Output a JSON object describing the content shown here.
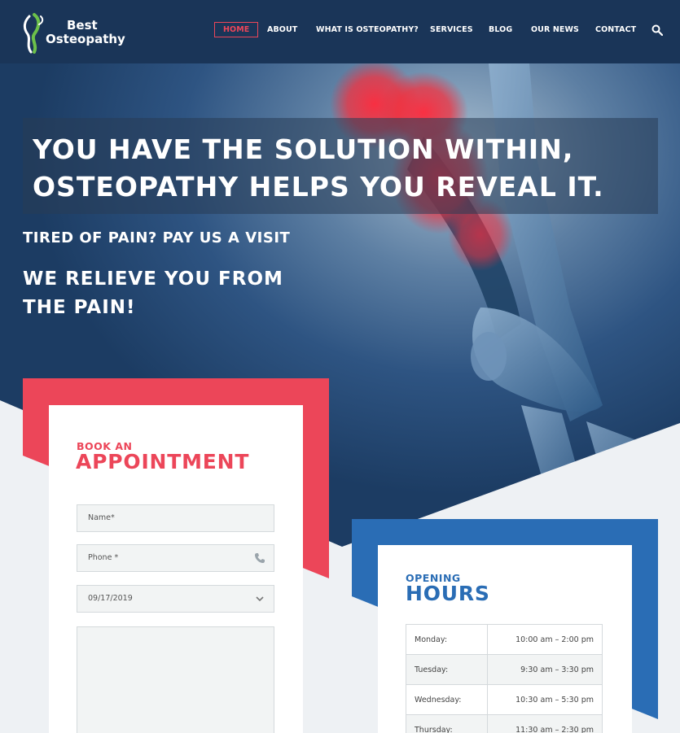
{
  "header": {
    "logo": {
      "line1": "Best",
      "line2": "Osteopathy"
    },
    "nav": [
      {
        "label": "HOME",
        "active": true
      },
      {
        "label": "ABOUT"
      },
      {
        "label": "WHAT IS OSTEOPATHY?"
      },
      {
        "label": "SERVICES"
      },
      {
        "label": "BLOG"
      },
      {
        "label": "OUR NEWS"
      },
      {
        "label": "CONTACT"
      }
    ],
    "search_icon": "search-icon"
  },
  "hero": {
    "title_line1": "YOU HAVE THE SOLUTION WITHIN,",
    "title_line2": "OSTEOPATHY HELPS YOU REVEAL IT.",
    "subtitle": "TIRED OF PAIN? PAY US A VISIT",
    "tagline_line1": "WE RELIEVE YOU FROM",
    "tagline_line2": "THE PAIN!"
  },
  "appointment": {
    "heading_small": "BOOK AN",
    "heading_big": "APPOINTMENT",
    "name_placeholder": "Name*",
    "phone_placeholder": "Phone *",
    "date_value": "09/17/2019",
    "message_placeholder": ""
  },
  "hours": {
    "heading_small": "OPENING",
    "heading_big": "HOURS",
    "rows": [
      {
        "day": "Monday:",
        "time": "10:00 am – 2:00 pm"
      },
      {
        "day": "Tuesday:",
        "time": "9:30 am – 3:30 pm"
      },
      {
        "day": "Wednesday:",
        "time": "10:30 am – 5:30 pm"
      },
      {
        "day": "Thursday:",
        "time": "11:30 am – 2:30 pm"
      }
    ]
  },
  "colors": {
    "navy": "#1a3558",
    "accent_red": "#ec4659",
    "accent_blue": "#2a6db5",
    "light_bg": "#eef1f4"
  }
}
